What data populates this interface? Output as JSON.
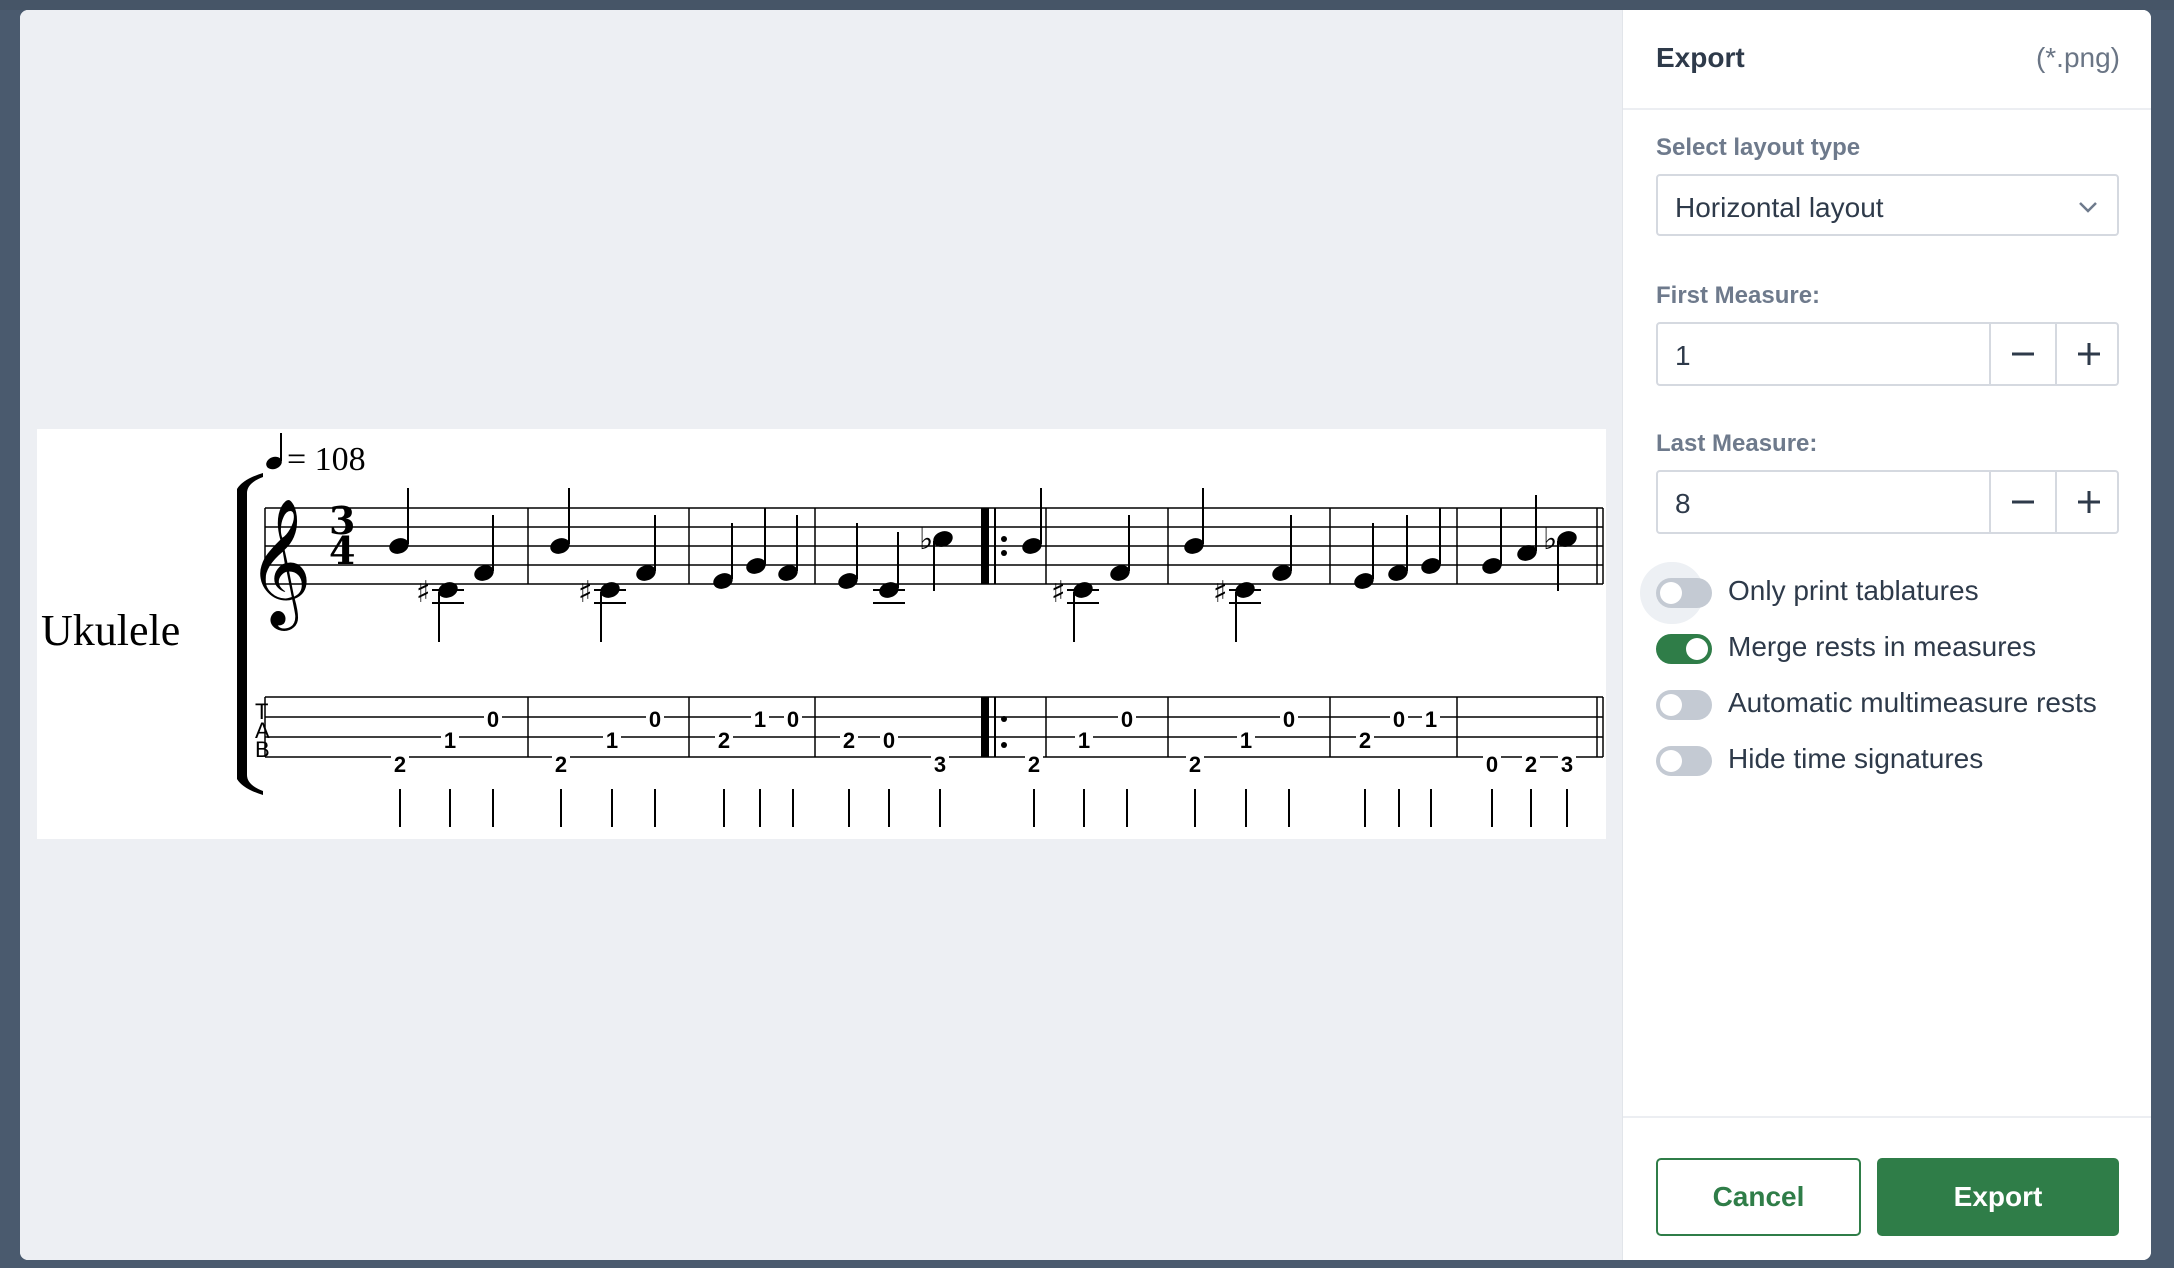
{
  "panel": {
    "title": "Export",
    "file_type": "(*.png)",
    "layout_label": "Select layout type",
    "layout_value": "Horizontal layout",
    "first_measure_label": "First Measure:",
    "first_measure_value": "1",
    "last_measure_label": "Last Measure:",
    "last_measure_value": "8",
    "toggles": [
      {
        "label": "Only print tablatures",
        "on": false
      },
      {
        "label": "Merge rests in measures",
        "on": true
      },
      {
        "label": "Automatic multimeasure rests",
        "on": false
      },
      {
        "label": "Hide time signatures",
        "on": false
      }
    ],
    "cancel_label": "Cancel",
    "export_label": "Export"
  },
  "score": {
    "instrument": "Ukulele",
    "tempo": "= 108",
    "time_signature": [
      "3",
      "4"
    ],
    "tab_letters": [
      "T",
      "A",
      "B"
    ],
    "tab_numbers": [
      {
        "s": 4,
        "t": "2"
      },
      {
        "s": 3,
        "t": "1"
      },
      {
        "s": 2,
        "t": "0"
      },
      {
        "s": 4,
        "t": "2"
      },
      {
        "s": 3,
        "t": "1"
      },
      {
        "s": 2,
        "t": "0"
      },
      {
        "s": 3,
        "t": "2"
      },
      {
        "s": 2,
        "t": "1"
      },
      {
        "s": 2,
        "t": "0"
      },
      {
        "s": 3,
        "t": "2"
      },
      {
        "s": 3,
        "t": "0"
      },
      {
        "s": 4,
        "t": "3"
      },
      {
        "s": 4,
        "t": "2"
      },
      {
        "s": 3,
        "t": "1"
      },
      {
        "s": 2,
        "t": "0"
      },
      {
        "s": 4,
        "t": "2"
      },
      {
        "s": 3,
        "t": "1"
      },
      {
        "s": 2,
        "t": "0"
      },
      {
        "s": 3,
        "t": "2"
      },
      {
        "s": 2,
        "t": "0"
      },
      {
        "s": 2,
        "t": "1"
      },
      {
        "s": 4,
        "t": "0"
      },
      {
        "s": 4,
        "t": "2"
      },
      {
        "s": 4,
        "t": "3"
      }
    ]
  }
}
